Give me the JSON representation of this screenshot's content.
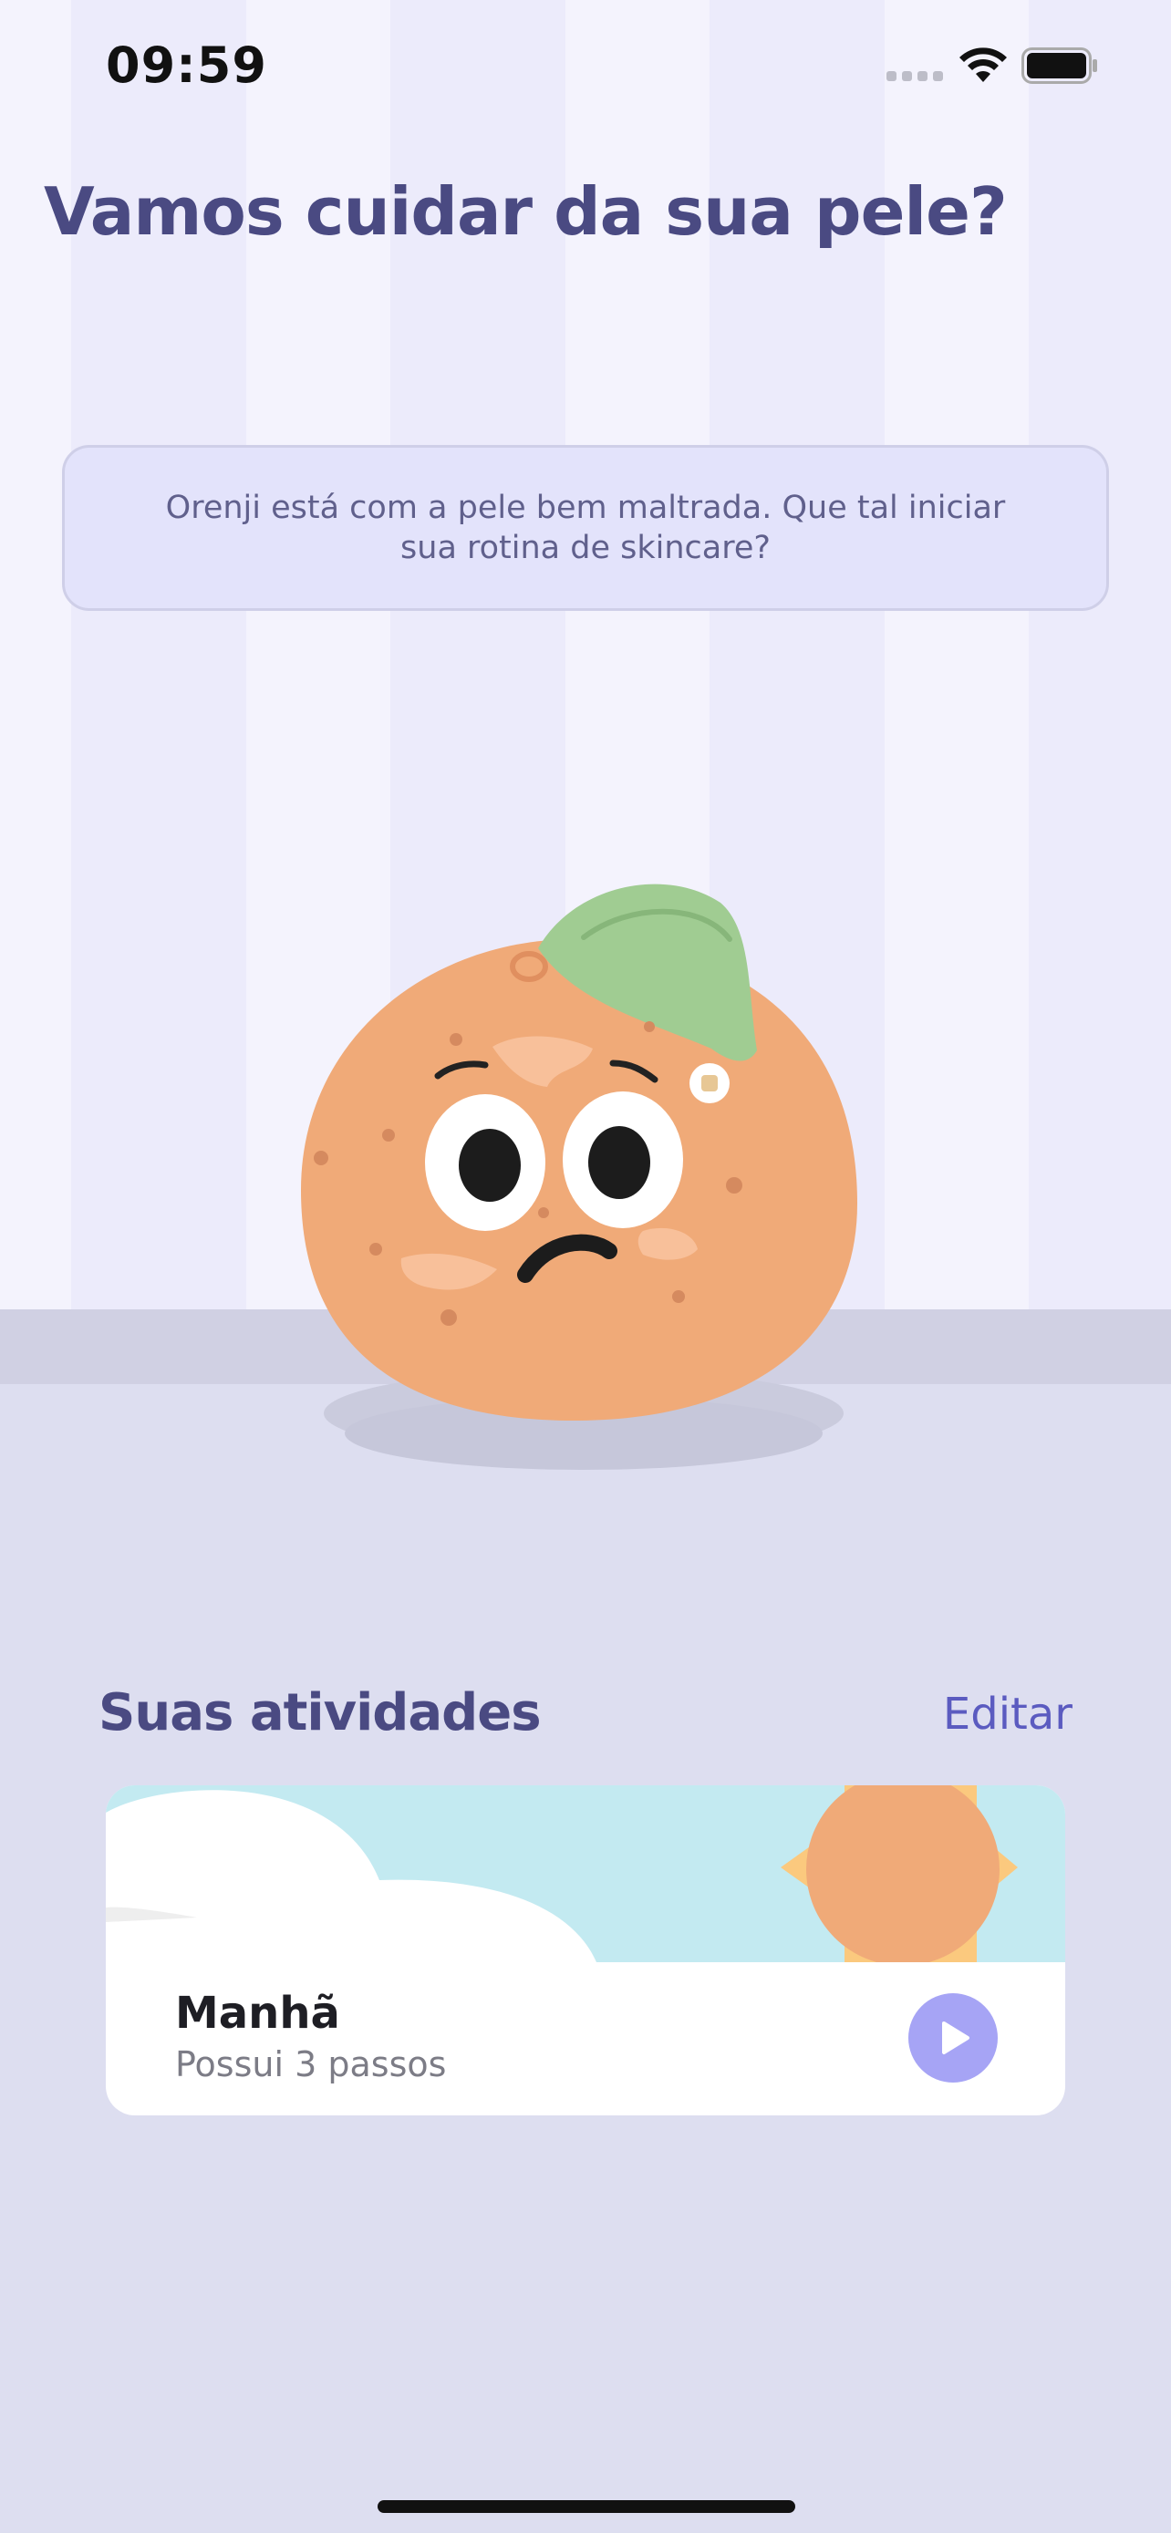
{
  "status_bar": {
    "time": "09:59",
    "icons": [
      "signal-icon",
      "wifi-icon",
      "battery-icon"
    ]
  },
  "header": {
    "title": "Vamos cuidar da sua pele?"
  },
  "speech_bubble": {
    "text": "Orenji está com a pele bem maltrada. Que tal iniciar sua rotina de skincare?"
  },
  "activities": {
    "title": "Suas atividades",
    "edit_label": "Editar",
    "items": [
      {
        "title": "Manhã",
        "subtitle": "Possui 3 passos",
        "icon": "play-icon"
      }
    ]
  },
  "colors": {
    "title": "#4a4a82",
    "accent": "#5b5bc0",
    "play_button": "#a6a4f5",
    "orange": "#f0aa78",
    "leaf": "#a0cc92",
    "sky": "#c3eaf1",
    "sun": "#fbc97e"
  }
}
